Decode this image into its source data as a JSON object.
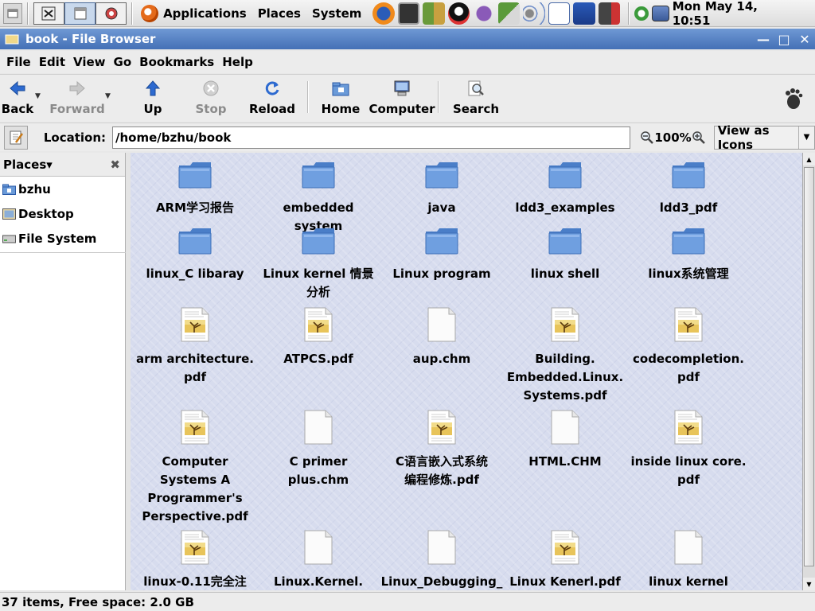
{
  "top_panel": {
    "menus": [
      "Applications",
      "Places",
      "System"
    ],
    "clock": "Mon May 14, 10:51"
  },
  "window": {
    "title": "book - File Browser"
  },
  "menubar": [
    "File",
    "Edit",
    "View",
    "Go",
    "Bookmarks",
    "Help"
  ],
  "toolbar": {
    "back": "Back",
    "forward": "Forward",
    "up": "Up",
    "stop": "Stop",
    "reload": "Reload",
    "home": "Home",
    "computer": "Computer",
    "search": "Search"
  },
  "location": {
    "label": "Location:",
    "value": "/home/bzhu/book",
    "zoom": "100%",
    "view_mode": "View as Icons"
  },
  "sidebar": {
    "title": "Places",
    "items": [
      {
        "label": "bzhu",
        "icon": "home-folder-icon"
      },
      {
        "label": "Desktop",
        "icon": "desktop-icon"
      },
      {
        "label": "File System",
        "icon": "drive-icon"
      }
    ]
  },
  "files": [
    {
      "name": "ARM学习报告",
      "type": "folder"
    },
    {
      "name": "embedded system",
      "type": "folder"
    },
    {
      "name": "java",
      "type": "folder"
    },
    {
      "name": "ldd3_examples",
      "type": "folder"
    },
    {
      "name": "ldd3_pdf",
      "type": "folder"
    },
    {
      "name": "linux_C libaray",
      "type": "folder"
    },
    {
      "name": "Linux kernel 情景\n分析",
      "type": "folder"
    },
    {
      "name": "Linux program",
      "type": "folder"
    },
    {
      "name": "linux shell",
      "type": "folder"
    },
    {
      "name": "linux系统管理",
      "type": "folder"
    },
    {
      "name": "arm architecture.\npdf",
      "type": "pdf"
    },
    {
      "name": "ATPCS.pdf",
      "type": "pdf"
    },
    {
      "name": "aup.chm",
      "type": "blank"
    },
    {
      "name": "Building.\nEmbedded.Linux.\nSystems.pdf",
      "type": "pdf"
    },
    {
      "name": "codecompletion.\npdf",
      "type": "pdf"
    },
    {
      "name": "Computer\nSystems A\nProgrammer's\nPerspective.pdf",
      "type": "pdf"
    },
    {
      "name": "C primer plus.chm",
      "type": "blank"
    },
    {
      "name": "C语言嵌入式系统\n编程修炼.pdf",
      "type": "pdf"
    },
    {
      "name": "HTML.CHM",
      "type": "blank"
    },
    {
      "name": "inside linux core.\npdf",
      "type": "pdf"
    },
    {
      "name": "linux-0.11完全注",
      "type": "pdf"
    },
    {
      "name": "Linux.Kernel.",
      "type": "blank"
    },
    {
      "name": "Linux_Debugging_",
      "type": "blank"
    },
    {
      "name": "Linux Kenerl.pdf",
      "type": "pdf"
    },
    {
      "name": "linux kernel",
      "type": "blank"
    }
  ],
  "status": "37 items, Free space: 2.0 GB"
}
